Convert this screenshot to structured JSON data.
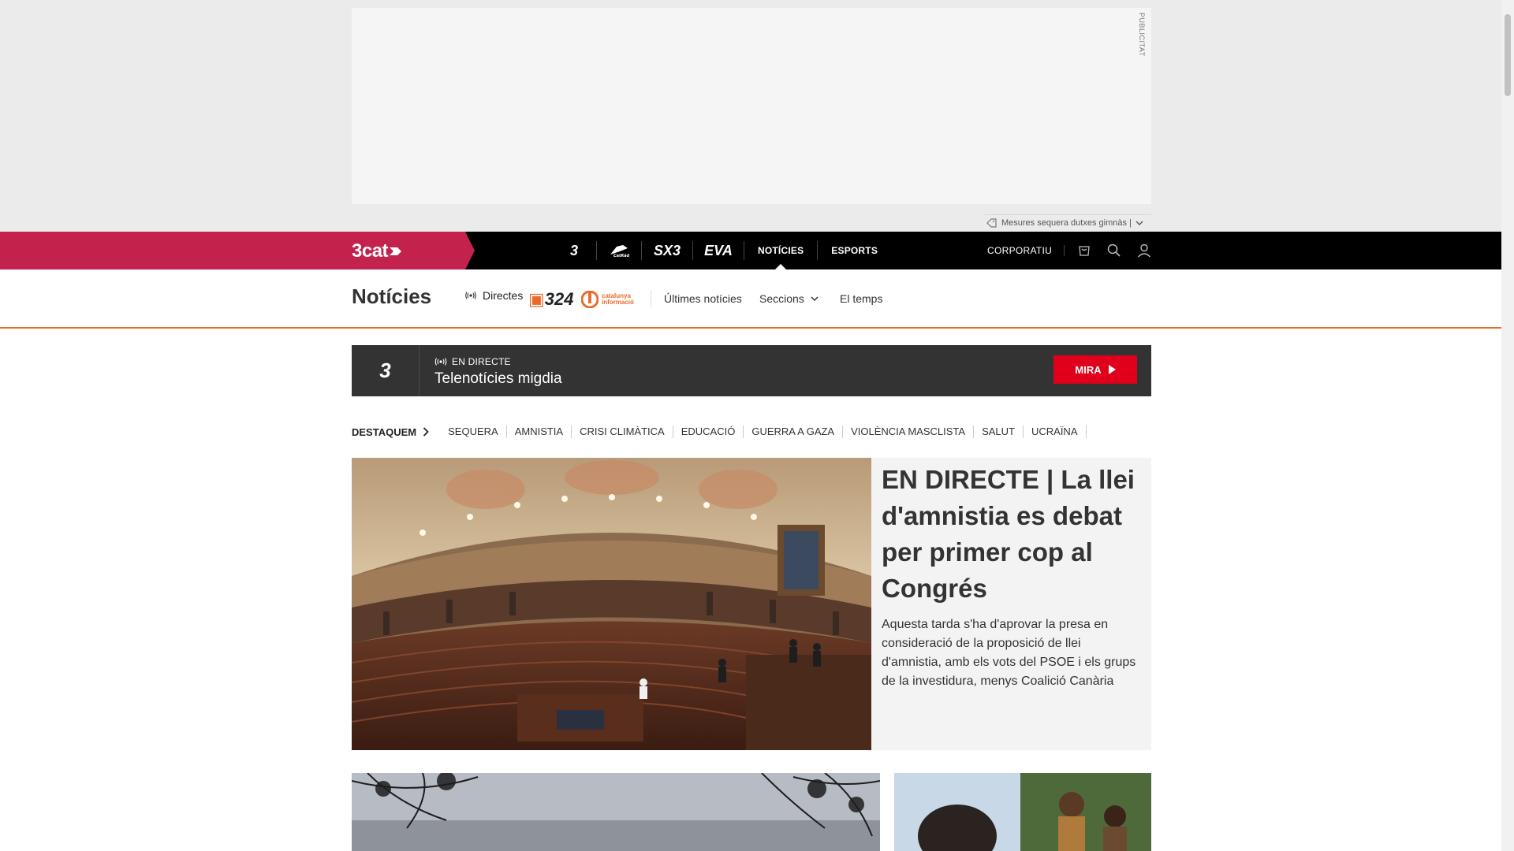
{
  "ad": {
    "tag": "PUBLICITAT",
    "notice": "Mesures sequera dutxes gimnàs |"
  },
  "topnav": {
    "brand": "3cat",
    "channels": [
      {
        "label": "3",
        "icon": "tv3-logo"
      },
      {
        "label": "Cat",
        "icon": "catradio-logo"
      },
      {
        "label": "SX3",
        "icon": "sx3-logo"
      },
      {
        "label": "EVA",
        "icon": "eva-logo"
      },
      {
        "label": "NOTÍCIES"
      },
      {
        "label": "ESPORTS"
      }
    ],
    "corporatiu": "CORPORATIU"
  },
  "section": {
    "title": "Notícies",
    "directes": "Directes",
    "logo324": "324",
    "logo_ci_line1": "catalunya",
    "logo_ci_line2": "informació",
    "links": [
      "Últimes notícies",
      "Seccions",
      "El temps"
    ]
  },
  "live": {
    "channel": "3",
    "tag": "EN DIRECTE",
    "title": "Telenotícies migdia",
    "button": "MIRA"
  },
  "tags": {
    "lead": "DESTAQUEM",
    "items": [
      "SEQUERA",
      "AMNISTIA",
      "CRISI CLIMÀTICA",
      "EDUCACIÓ",
      "GUERRA A GAZA",
      "VIOLÈNCIA MASCLISTA",
      "SALUT",
      "UCRAÏNA"
    ]
  },
  "featured": {
    "title": "EN DIRECTE | La llei d'amnistia es debat per primer cop al Congrés",
    "summary": "Aquesta tarda s'ha d'aprovar la presa en consideració de la proposició de llei d'amnistia, amb els vots del PSOE i els grups de la investidura, menys Coalició Canària"
  },
  "colors": {
    "brand_pink": "#c3224d",
    "accent_orange": "#e96b2c",
    "live_red": "#e0001b"
  }
}
